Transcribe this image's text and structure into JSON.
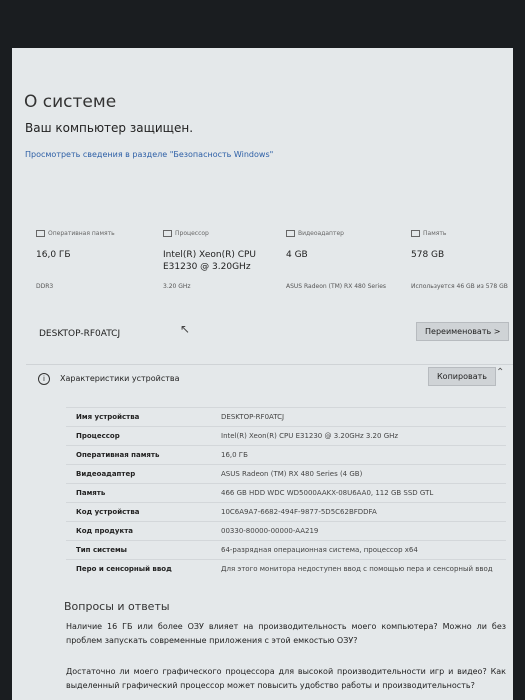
{
  "page": {
    "title": "О системе",
    "protected": "Ваш компьютер защищен.",
    "security_link": "Просмотреть сведения в разделе \"Безопасность Windows\""
  },
  "cards": [
    {
      "icon": "ram-icon",
      "label": "Оперативная память",
      "value": "16,0 ГБ",
      "sub": "DDR3"
    },
    {
      "icon": "cpu-icon",
      "label": "Процессор",
      "value": "Intel(R) Xeon(R) CPU E31230 @ 3.20GHz",
      "sub": "3.20 GHz"
    },
    {
      "icon": "gpu-icon",
      "label": "Видеоадаптер",
      "value": "4 GB",
      "sub": "ASUS Radeon (TM) RX 480 Series"
    },
    {
      "icon": "storage-icon",
      "label": "Память",
      "value": "578 GB",
      "sub": "Используется 46 GB из 578 GB"
    }
  ],
  "device_name": "DESKTOP-RF0ATCJ",
  "rename_label": "Переименовать >",
  "specs_section": {
    "title": "Характеристики устройства",
    "copy_label": "Копировать",
    "rows": [
      {
        "k": "Имя устройства",
        "v": "DESKTOP-RF0ATCJ"
      },
      {
        "k": "Процессор",
        "v": "Intel(R) Xeon(R) CPU E31230 @ 3.20GHz   3.20 GHz"
      },
      {
        "k": "Оперативная память",
        "v": "16,0 ГБ"
      },
      {
        "k": "Видеоадаптер",
        "v": "ASUS Radeon (TM) RX 480 Series (4 GB)"
      },
      {
        "k": "Память",
        "v": "466 GB HDD WDC WD5000AAKX-08U6AA0, 112 GB SSD GTL"
      },
      {
        "k": "Код устройства",
        "v": "10C6A9A7-6682-494F-9877-5D5C62BFDDFA"
      },
      {
        "k": "Код продукта",
        "v": "00330-80000-00000-AA219"
      },
      {
        "k": "Тип системы",
        "v": "64-разрядная операционная система, процессор x64"
      },
      {
        "k": "Перо и сенсорный ввод",
        "v": "Для этого монитора недоступен ввод с помощью пера и сенсорный ввод"
      }
    ]
  },
  "faq": {
    "title": "Вопросы и ответы",
    "q1": "Наличие 16 ГБ или более ОЗУ влияет на производительность моего компьютера? Можно ли без проблем запускать современные приложения с этой емкостью ОЗУ?",
    "q2": "Достаточно ли моего графического процессора для высокой производительности игр и видео? Как выделенный графический процессор может повысить удобство работы и производительность?"
  }
}
